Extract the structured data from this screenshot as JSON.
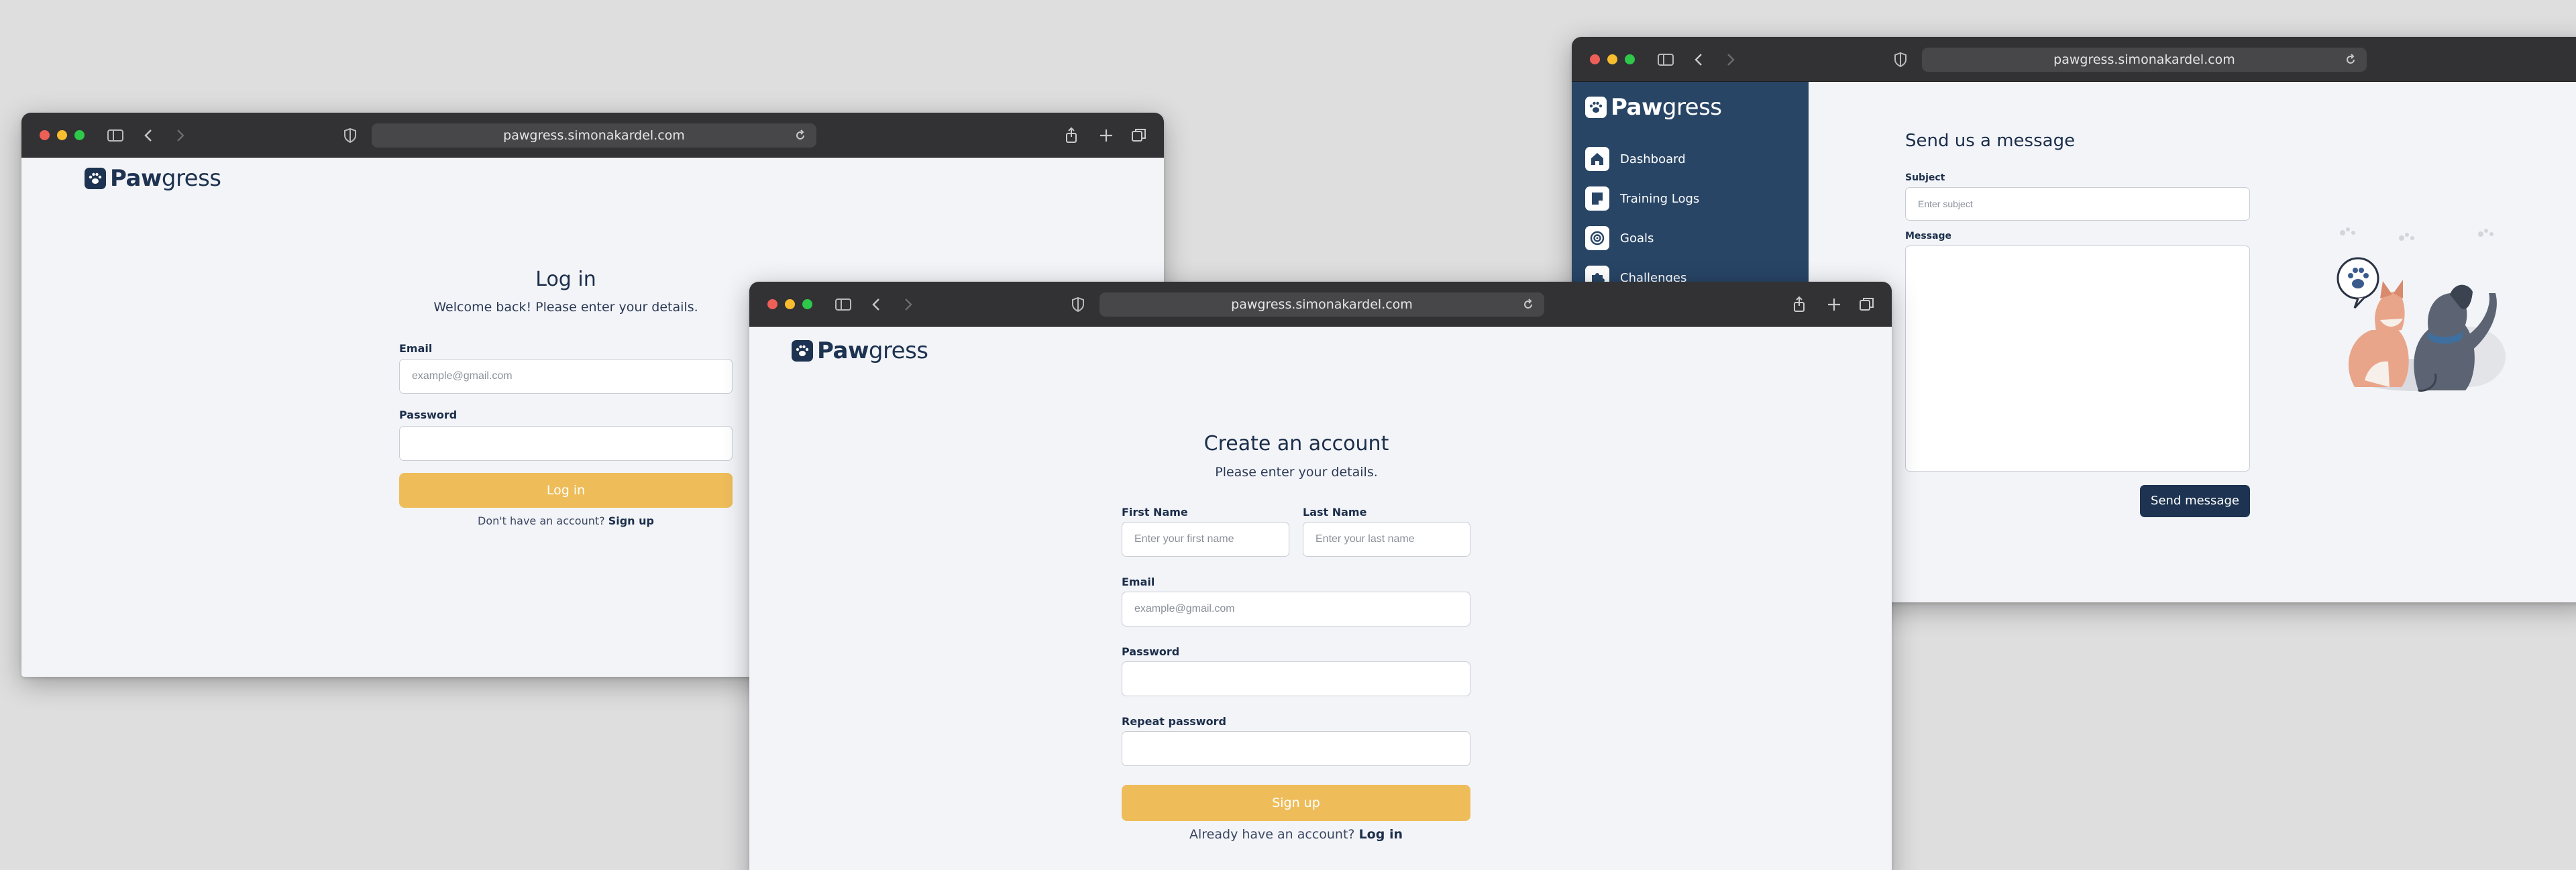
{
  "colors": {
    "navy": "#1d3351",
    "sidebar": "#284566",
    "accent": "#eebd5a",
    "chrome": "#323234",
    "page": "#f3f4f8"
  },
  "login_window": {
    "url": "pawgress.simonakardel.com",
    "logo": {
      "bold": "Paw",
      "light": "gress"
    },
    "title": "Log in",
    "subtitle": "Welcome back! Please enter your details.",
    "email_label": "Email",
    "email_placeholder": "example@gmail.com",
    "password_label": "Password",
    "submit_label": "Log in",
    "footer_text": "Don't have an account?",
    "footer_link": "Sign up"
  },
  "contact_window": {
    "url": "pawgress.simonakardel.com",
    "logo": {
      "bold": "Paw",
      "light": "gress"
    },
    "nav": [
      {
        "label": "Dashboard",
        "icon": "home-icon"
      },
      {
        "label": "Training Logs",
        "icon": "notebook-icon"
      },
      {
        "label": "Goals",
        "icon": "target-icon"
      },
      {
        "label": "Challenges",
        "icon": "puzzle-icon"
      }
    ],
    "title": "Send us a message",
    "subject_label": "Subject",
    "subject_placeholder": "Enter subject",
    "message_label": "Message",
    "submit_label": "Send message"
  },
  "signup_window": {
    "url": "pawgress.simonakardel.com",
    "logo": {
      "bold": "Paw",
      "light": "gress"
    },
    "title": "Create an account",
    "subtitle": "Please enter your details.",
    "first_name_label": "First Name",
    "first_name_placeholder": "Enter your first name",
    "last_name_label": "Last Name",
    "last_name_placeholder": "Enter your last name",
    "email_label": "Email",
    "email_placeholder": "example@gmail.com",
    "password_label": "Password",
    "repeat_password_label": "Repeat password",
    "submit_label": "Sign up",
    "footer_text": "Already have an account?",
    "footer_link": "Log in"
  }
}
